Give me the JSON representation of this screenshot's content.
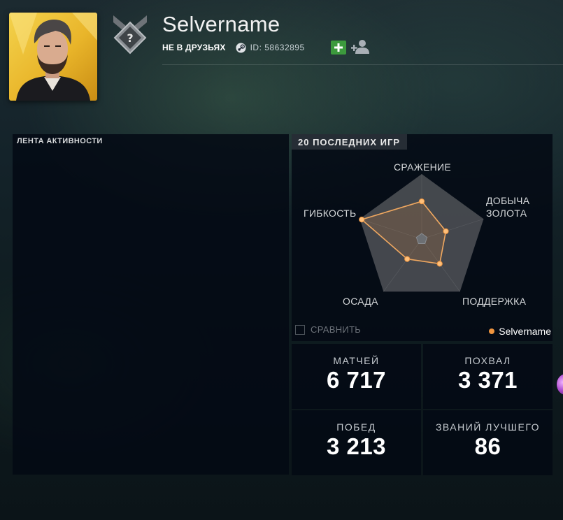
{
  "profile": {
    "name": "Selvername",
    "friend_status": "НЕ В ДРУЗЬЯХ",
    "steam_id": "ID: 58632895",
    "avatar": "portrait-photo",
    "rank_icon": "unknown-rank-medal"
  },
  "header_actions": {
    "add_friend_icon": "plus-icon",
    "add_person_icon": "add-person-icon"
  },
  "activity": {
    "title": "ЛЕНТА АКТИВНОСТИ"
  },
  "recent_games": {
    "title": "20 ПОСЛЕДНИХ ИГР",
    "axes": {
      "fighting": "СРАЖЕНИЕ",
      "farming_line1": "ДОБЫЧА",
      "farming_line2": "ЗОЛОТА",
      "support": "ПОДДЕРЖКА",
      "pushing": "ОСАДА",
      "versatility": "ГИБКОСТЬ"
    },
    "compare_label": "СРАВНИТЬ",
    "legend_label": "Selvername",
    "colors": {
      "player": "#f0953f",
      "pentagon": "#4a4d52"
    },
    "chart_data": {
      "type": "radar",
      "axes": [
        "СРАЖЕНИЕ",
        "ДОБЫЧА ЗОЛОТА",
        "ПОДДЕРЖКА",
        "ОСАДА",
        "ГИБКОСТЬ"
      ],
      "series": [
        {
          "name": "Selvername",
          "values": [
            0.58,
            0.39,
            0.47,
            0.38,
            0.97
          ]
        }
      ],
      "range": [
        0,
        1
      ]
    }
  },
  "stats": {
    "matches": {
      "label": "МАТЧЕЙ",
      "value": "6 717"
    },
    "commends": {
      "label": "ПОХВАЛ",
      "value": "3 371"
    },
    "wins": {
      "label": "ПОБЕД",
      "value": "3 213"
    },
    "mvp": {
      "label": "ЗВАНИЙ ЛУЧШЕГО",
      "value": "86"
    }
  }
}
